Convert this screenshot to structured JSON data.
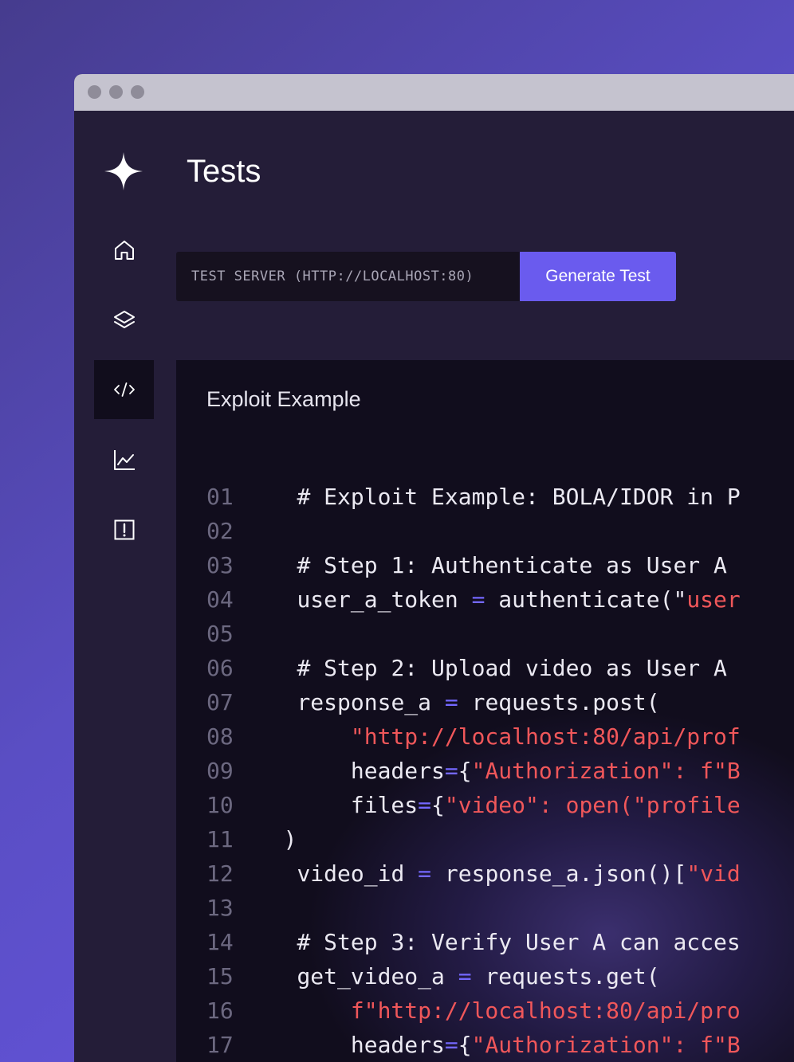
{
  "app": {
    "title": "Tests",
    "logo_icon": "sparkle-icon"
  },
  "sidebar": {
    "items": [
      {
        "name": "home",
        "icon": "home-icon",
        "active": false
      },
      {
        "name": "layers",
        "icon": "layers-icon",
        "active": false
      },
      {
        "name": "code",
        "icon": "code-icon",
        "active": true
      },
      {
        "name": "analytics",
        "icon": "chart-icon",
        "active": false
      },
      {
        "name": "alerts",
        "icon": "alert-icon",
        "active": false
      }
    ]
  },
  "toolbar": {
    "server_placeholder": "TEST SERVER (HTTP://LOCALHOST:80)",
    "server_value": "",
    "generate_label": "Generate Test"
  },
  "code_panel": {
    "title": "Exploit Example",
    "lines": [
      {
        "n": "01",
        "indent": "    ",
        "tokens": [
          {
            "t": "cm",
            "v": "# Exploit Example: BOLA/IDOR in P"
          }
        ]
      },
      {
        "n": "02",
        "indent": "",
        "tokens": []
      },
      {
        "n": "03",
        "indent": "    ",
        "tokens": [
          {
            "t": "cm",
            "v": "# Step 1: Authenticate as User A"
          }
        ]
      },
      {
        "n": "04",
        "indent": "    ",
        "tokens": [
          {
            "t": "txt",
            "v": "user_a_token "
          },
          {
            "t": "op",
            "v": "="
          },
          {
            "t": "txt",
            "v": " authenticate(\""
          },
          {
            "t": "str",
            "v": "user"
          }
        ]
      },
      {
        "n": "05",
        "indent": "",
        "tokens": []
      },
      {
        "n": "06",
        "indent": "    ",
        "tokens": [
          {
            "t": "cm",
            "v": "# Step 2: Upload video as User A"
          }
        ]
      },
      {
        "n": "07",
        "indent": "    ",
        "tokens": [
          {
            "t": "txt",
            "v": "response_a "
          },
          {
            "t": "op",
            "v": "="
          },
          {
            "t": "txt",
            "v": " requests.post("
          }
        ]
      },
      {
        "n": "08",
        "indent": "        ",
        "tokens": [
          {
            "t": "str",
            "v": "\"http://localhost:80/api/prof"
          }
        ]
      },
      {
        "n": "09",
        "indent": "        ",
        "tokens": [
          {
            "t": "txt",
            "v": "headers"
          },
          {
            "t": "op",
            "v": "="
          },
          {
            "t": "txt",
            "v": "{"
          },
          {
            "t": "str",
            "v": "\"Authorization\": f\"B"
          }
        ]
      },
      {
        "n": "10",
        "indent": "        ",
        "tokens": [
          {
            "t": "txt",
            "v": "files"
          },
          {
            "t": "op",
            "v": "="
          },
          {
            "t": "txt",
            "v": "{"
          },
          {
            "t": "str",
            "v": "\"video\": open(\"profile"
          }
        ]
      },
      {
        "n": "11",
        "indent": "   ",
        "tokens": [
          {
            "t": "txt",
            "v": ")"
          }
        ]
      },
      {
        "n": "12",
        "indent": "    ",
        "tokens": [
          {
            "t": "txt",
            "v": "video_id "
          },
          {
            "t": "op",
            "v": "="
          },
          {
            "t": "txt",
            "v": " response_a.json()["
          },
          {
            "t": "str",
            "v": "\"vid"
          }
        ]
      },
      {
        "n": "13",
        "indent": "",
        "tokens": []
      },
      {
        "n": "14",
        "indent": "    ",
        "tokens": [
          {
            "t": "cm",
            "v": "# Step 3: Verify User A can acces"
          }
        ]
      },
      {
        "n": "15",
        "indent": "    ",
        "tokens": [
          {
            "t": "txt",
            "v": "get_video_a "
          },
          {
            "t": "op",
            "v": "="
          },
          {
            "t": "txt",
            "v": " requests.get("
          }
        ]
      },
      {
        "n": "16",
        "indent": "        ",
        "tokens": [
          {
            "t": "str",
            "v": "f\"http://localhost:80/api/pro"
          }
        ]
      },
      {
        "n": "17",
        "indent": "        ",
        "tokens": [
          {
            "t": "txt",
            "v": "headers"
          },
          {
            "t": "op",
            "v": "="
          },
          {
            "t": "txt",
            "v": "{"
          },
          {
            "t": "str",
            "v": "\"Authorization\": f\"B"
          }
        ]
      }
    ]
  },
  "colors": {
    "accent": "#6a5bee",
    "string": "#f0575a",
    "operator": "#7468ff",
    "line_number": "#6c6880"
  }
}
